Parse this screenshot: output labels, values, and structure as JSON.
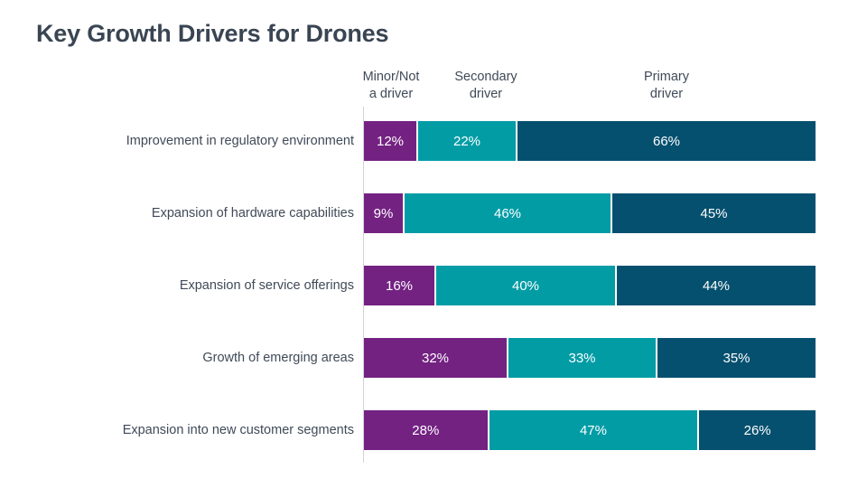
{
  "chart_data": {
    "type": "bar",
    "subtype": "horizontal-stacked-100",
    "title": "Key Growth Drivers for Drones",
    "xlabel": "",
    "ylabel": "",
    "xlim": [
      0,
      100
    ],
    "grid": false,
    "legend_position": "top",
    "value_suffix": "%",
    "categories": [
      "Improvement in regulatory environment",
      "Expansion of hardware capabilities",
      "Expansion of service offerings",
      "Growth of emerging areas",
      "Expansion into new customer segments"
    ],
    "series": [
      {
        "name": "Minor/Not a driver",
        "name_lines": [
          "Minor/Not",
          "a driver"
        ],
        "color": "#732282",
        "values": [
          12,
          9,
          16,
          32,
          28
        ],
        "labels": [
          "12%",
          "9%",
          "16%",
          "32%",
          "28%"
        ]
      },
      {
        "name": "Secondary driver",
        "name_lines": [
          "Secondary",
          "driver"
        ],
        "color": "#029CA5",
        "values": [
          22,
          46,
          40,
          33,
          47
        ],
        "labels": [
          "22%",
          "46%",
          "40%",
          "33%",
          "47%"
        ]
      },
      {
        "name": "Primary driver",
        "name_lines": [
          "Primary",
          "driver"
        ],
        "color": "#06506F",
        "values": [
          66,
          45,
          44,
          35,
          26
        ],
        "labels": [
          "66%",
          "45%",
          "44%",
          "35%",
          "26%"
        ]
      }
    ],
    "header_positions_pct": [
      12,
      37,
      76
    ],
    "colors": {
      "title": "#3a4553",
      "text": "#3f4a58",
      "axis": "#d2d3d6",
      "background": "#ffffff",
      "data_label": "#ffffff"
    }
  }
}
